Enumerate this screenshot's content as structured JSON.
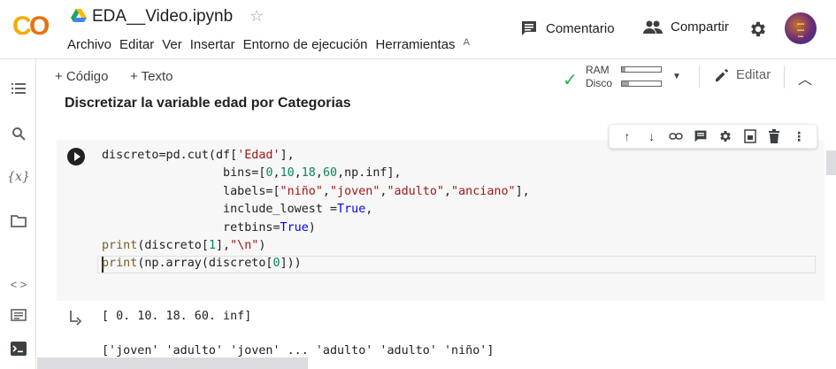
{
  "header": {
    "logo": "CO",
    "notebook_title": "EDA__Video.ipynb",
    "menu": [
      "Archivo",
      "Editar",
      "Ver",
      "Insertar",
      "Entorno de ejecución",
      "Herramientas",
      "A"
    ],
    "comment_label": "Comentario",
    "share_label": "Compartir"
  },
  "toolbar": {
    "add_code": "+ Código",
    "add_text": "+ Texto",
    "ram_label": "RAM",
    "disk_label": "Disco",
    "ram_fraction": 0.08,
    "disk_fraction": 0.18,
    "edit_label": "Editar"
  },
  "sidebar": {
    "icons": [
      "table-of-contents-icon",
      "search-icon",
      "variables-icon",
      "files-icon",
      "code-snippets-icon",
      "command-palette-icon",
      "terminal-icon"
    ],
    "variables_label": "{x}"
  },
  "section": {
    "heading": "Discretizar la variable edad por Categorias"
  },
  "cell": {
    "code_lines": [
      "discreto=pd.cut(df['Edad'],",
      "                 bins=[0,10,18,60,np.inf],",
      "                 labels=[\"niño\",\"joven\",\"adulto\",\"anciano\"],",
      "                 include_lowest =True,",
      "                 retbins=True)",
      "print(discreto[1],\"\\n\")",
      "print(np.array(discreto[0]))"
    ],
    "output_lines": [
      "[ 0. 10. 18. 60. inf]",
      "['joven' 'adulto' 'joven' ... 'adulto' 'adulto' 'niño']"
    ]
  },
  "colors": {
    "logo_orange": "#f9ab00",
    "logo_dark_orange": "#e8710a",
    "check_green": "#34a853",
    "string_red": "#a31515",
    "number_green": "#098658",
    "keyword_blue": "#0000ff"
  }
}
